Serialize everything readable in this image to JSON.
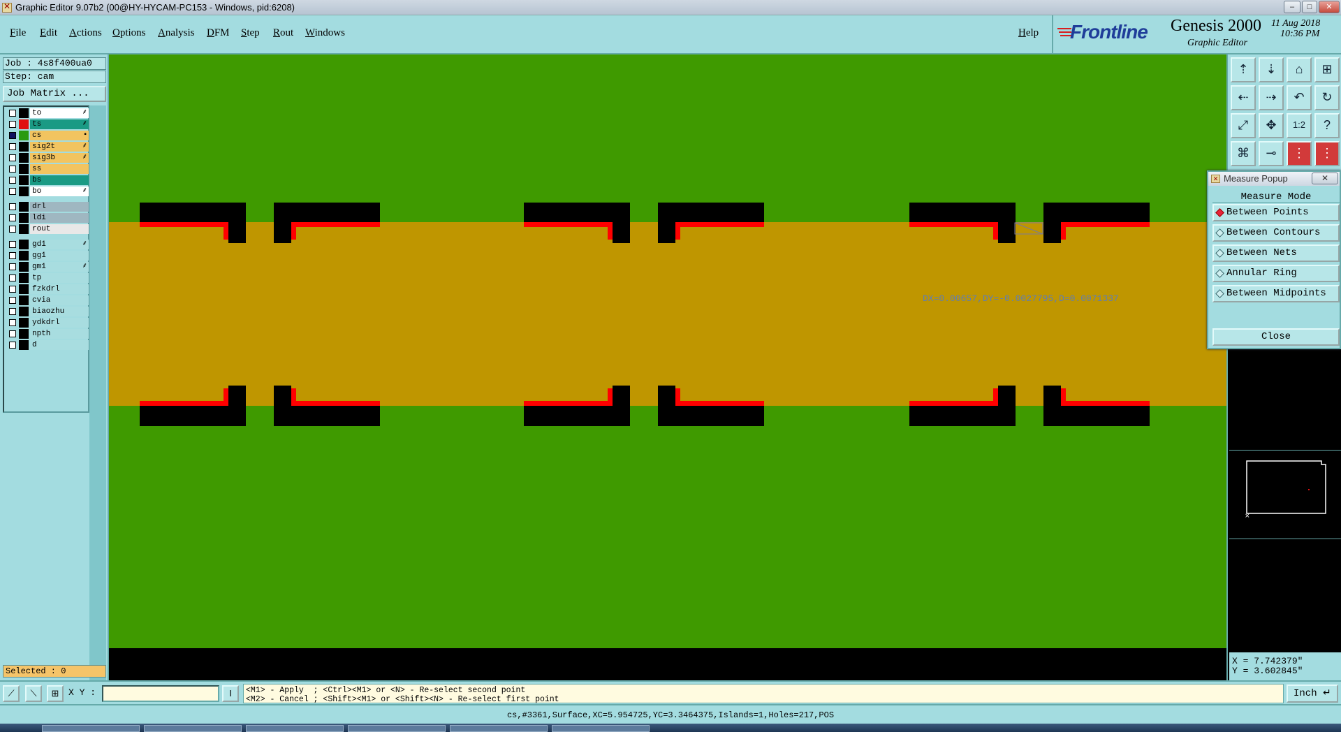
{
  "window": {
    "title": "Graphic Editor 9.07b2 (00@HY-HYCAM-PC153 - Windows, pid:6208)"
  },
  "menu": [
    "File",
    "Edit",
    "Actions",
    "Options",
    "Analysis",
    "DFM",
    "Step",
    "Rout",
    "Windows"
  ],
  "help": "Help",
  "brand": {
    "logo": "Frontline",
    "product": "Genesis 2000",
    "subtitle": "Graphic Editor",
    "date": "11 Aug 2018",
    "time": "10:36 PM"
  },
  "job": {
    "job_label": "Job : 4s8f400ua0",
    "step_label": "Step: cam",
    "matrix_button": "Job Matrix ..."
  },
  "layers": [
    {
      "name": "to",
      "color": "#ffffff",
      "swatch": "#000000",
      "checked": false,
      "mark": "⸙"
    },
    {
      "name": "ts",
      "color": "#1a9a84",
      "swatch": "#e01010",
      "checked": false,
      "mark": "⸙"
    },
    {
      "name": "cs",
      "color": "#f2c460",
      "swatch": "#2a9a10",
      "checked": true,
      "mark": "▪"
    },
    {
      "name": "sig2t",
      "color": "#f2c460",
      "swatch": "#000000",
      "checked": false,
      "mark": "⸙"
    },
    {
      "name": "sig3b",
      "color": "#f2c460",
      "swatch": "#000000",
      "checked": false,
      "mark": "⸙"
    },
    {
      "name": "ss",
      "color": "#f2c460",
      "swatch": "#000000",
      "checked": false,
      "mark": ""
    },
    {
      "name": "bs",
      "color": "#1a9a84",
      "swatch": "#000000",
      "checked": false,
      "mark": ""
    },
    {
      "name": "bo",
      "color": "#ffffff",
      "swatch": "#000000",
      "checked": false,
      "mark": "⸙"
    },
    {
      "name": "drl",
      "color": "#9fb7c1",
      "swatch": "#000000",
      "checked": false,
      "mark": ""
    },
    {
      "name": "ldi",
      "color": "#9fb7c1",
      "swatch": "#000000",
      "checked": false,
      "mark": ""
    },
    {
      "name": "rout",
      "color": "#e8e8e8",
      "swatch": "#000000",
      "checked": false,
      "mark": ""
    },
    {
      "name": "gd1",
      "color": "#a8dde0",
      "swatch": "#000000",
      "checked": false,
      "mark": "⸙"
    },
    {
      "name": "gg1",
      "color": "#a8dde0",
      "swatch": "#000000",
      "checked": false,
      "mark": ""
    },
    {
      "name": "gm1",
      "color": "#a8dde0",
      "swatch": "#000000",
      "checked": false,
      "mark": "⸙"
    },
    {
      "name": "tp",
      "color": "#a8dde0",
      "swatch": "#000000",
      "checked": false,
      "mark": ""
    },
    {
      "name": "fzkdrl",
      "color": "#a8dde0",
      "swatch": "#000000",
      "checked": false,
      "mark": ""
    },
    {
      "name": "cvia",
      "color": "#a8dde0",
      "swatch": "#000000",
      "checked": false,
      "mark": ""
    },
    {
      "name": "biaozhu",
      "color": "#a8dde0",
      "swatch": "#000000",
      "checked": false,
      "mark": ""
    },
    {
      "name": "ydkdrl",
      "color": "#a8dde0",
      "swatch": "#000000",
      "checked": false,
      "mark": ""
    },
    {
      "name": "npth",
      "color": "#a8dde0",
      "swatch": "#000000",
      "checked": false,
      "mark": ""
    },
    {
      "name": "d",
      "color": "#a8dde0",
      "swatch": "#000000",
      "checked": false,
      "mark": ""
    }
  ],
  "selected": "Selected : 0",
  "canvas": {
    "measure_readout": "DX=0.00657,DY=-0.0027795,D=0.0071337",
    "bg": "#3f9a00",
    "strip": "#bf9600"
  },
  "measure_popup": {
    "title": "Measure Popup",
    "mode_header": "Measure Mode",
    "options": [
      {
        "label": "Between Points",
        "selected": true
      },
      {
        "label": "Between Contours",
        "selected": false
      },
      {
        "label": "Between Nets",
        "selected": false
      },
      {
        "label": "Annular Ring",
        "selected": false
      },
      {
        "label": "Between Midpoints",
        "selected": false
      }
    ],
    "close": "Close"
  },
  "coords": {
    "x": "X = 7.742379\"",
    "y": "Y = 3.602845\""
  },
  "command": {
    "xy_label": "X Y :",
    "xy_value": "",
    "prompt_line1": "<M1> - Apply  ; <Ctrl><M1> or <N> - Re-select second point",
    "prompt_line2": "<M2> - Cancel ; <Shift><M1> or <Shift><N> - Re-select first point",
    "units": "Inch"
  },
  "status": "cs,#3361,Surface,XC=5.954725,YC=3.3464375,Islands=1,Holes=217,POS"
}
